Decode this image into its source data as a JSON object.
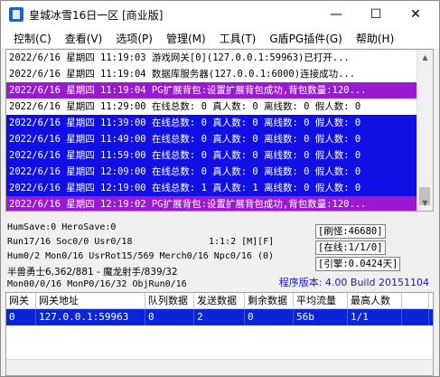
{
  "window": {
    "title": "皇城冰雪16日一区 [商业版]",
    "minimize": "—",
    "maximize": "☐",
    "close": "✕"
  },
  "menu": [
    {
      "label": "控制(C)"
    },
    {
      "label": "查看(V)"
    },
    {
      "label": "选项(P)"
    },
    {
      "label": "管理(M)"
    },
    {
      "label": "工具(T)"
    },
    {
      "label": "G盾PG插件(G)"
    },
    {
      "label": "帮助(H)"
    }
  ],
  "log": [
    {
      "text": "2022/6/16 星期四 11:19:03 游戏网关[0](127.0.0.1:59963)已打开...",
      "style": "normal"
    },
    {
      "text": "2022/6/16 星期四 11:19:04 数据库服务器(127.0.0.1:6000)连接成功...",
      "style": "normal"
    },
    {
      "text": "2022/6/16 星期四 11:19:04 PG扩展背包:设置扩展背包成功,背包数量:120...",
      "style": "warn"
    },
    {
      "text": "2022/6/16 星期四 11:29:00 在线总数: 0 真人数: 0 离线数: 0 假人数: 0",
      "style": "normal"
    },
    {
      "text": "2022/6/16 星期四 11:39:00 在线总数: 0 真人数: 0 离线数: 0 假人数: 0",
      "style": "info"
    },
    {
      "text": "2022/6/16 星期四 11:49:00 在线总数: 0 真人数: 0 离线数: 0 假人数: 0",
      "style": "info"
    },
    {
      "text": "2022/6/16 星期四 11:59:00 在线总数: 0 真人数: 0 离线数: 0 假人数: 0",
      "style": "info"
    },
    {
      "text": "2022/6/16 星期四 12:09:00 在线总数: 0 真人数: 0 离线数: 0 假人数: 0",
      "style": "info"
    },
    {
      "text": "2022/6/16 星期四 12:19:00 在线总数: 1 真人数: 1 离线数: 0 假人数: 0",
      "style": "info"
    },
    {
      "text": "2022/6/16 星期四 12:19:02 PG扩展背包:设置扩展背包成功,背包数量:120...",
      "style": "warn"
    }
  ],
  "status": {
    "line1": "HumSave:0 HeroSave:0",
    "line2a": "Run17/16 Soc0/0 Usr0/18",
    "line2b": "1:1:2 [M][F]",
    "line3": "Hum0/2 Mon0/16 UsrRot15/569 Merch0/16 Npc0/16 (0)",
    "line4": "半兽勇士6,362/881 - 魔龙射手/839/32",
    "line5": "Mon00/0/16 MonP0/16/32 ObjRun0/16",
    "refresh": "[刷怪:46680]",
    "online": "[在线:1/1/0]",
    "bound": "[引擎:0.0424天]",
    "version": "程序版本: 4.00 Build 20151104"
  },
  "table": {
    "headers": [
      "网关",
      "网关地址",
      "队列数据",
      "发送数据",
      "剩余数据",
      "平均流量",
      "最高人数",
      ""
    ],
    "rows": [
      [
        "0",
        "127.0.0.1:59963",
        "0",
        "2",
        "0",
        "56b",
        "1/1",
        ""
      ]
    ]
  },
  "colors": {
    "warn_bg": "#9a1ad1",
    "info_bg": "#1010e6",
    "selected_row": "#0a24d8",
    "version_text": "#1a1ab8"
  }
}
